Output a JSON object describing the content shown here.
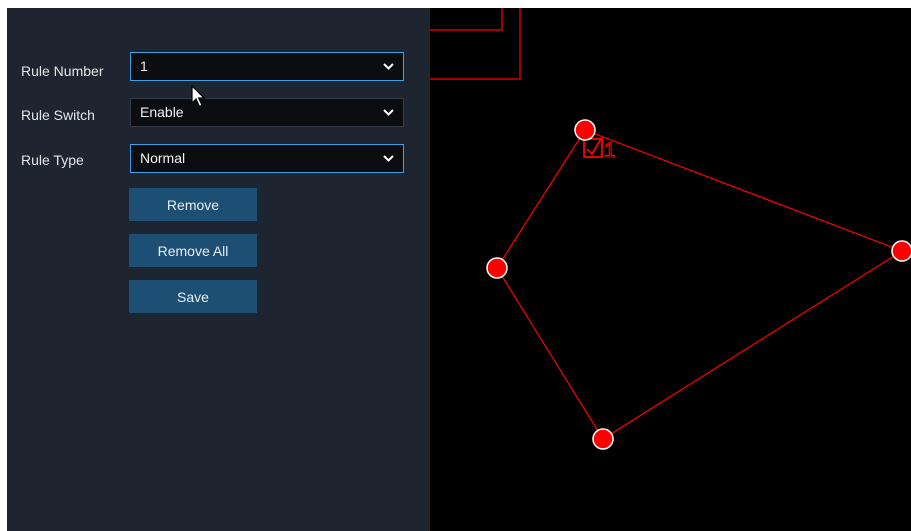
{
  "form": {
    "rule_number": {
      "label": "Rule Number",
      "value": "1"
    },
    "rule_switch": {
      "label": "Rule Switch",
      "value": "Enable"
    },
    "rule_type": {
      "label": "Rule Type",
      "value": "Normal"
    }
  },
  "buttons": {
    "remove": "Remove",
    "remove_all": "Remove All",
    "save": "Save"
  },
  "region": {
    "label": "1",
    "color": "#ff0000"
  },
  "icons": {
    "dropdown": "chevron-down-icon",
    "cursor": "mouse-pointer-icon",
    "checkbox": "checkbox-checked-icon"
  },
  "colors": {
    "panel_bg": "#1c2530",
    "button_bg": "#1d4f74",
    "focus_border": "#3d9fe4",
    "video_bg": "#000000"
  }
}
